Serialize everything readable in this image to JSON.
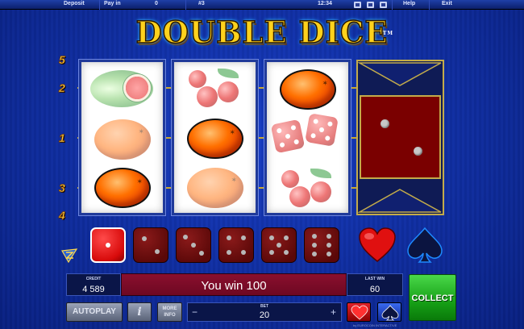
{
  "topbar": {
    "deposit": "Deposit",
    "pay_in": "Pay in",
    "pay_in_value": "0",
    "game_id": "#3",
    "clock": "12:34",
    "help": "Help",
    "exit": "Exit",
    "icons": [
      "sound-icon",
      "fullscreen-icon",
      "settings-icon"
    ]
  },
  "game": {
    "title": "DOUBLE DICE",
    "trademark": "TM"
  },
  "paylines": {
    "numbers": [
      "5",
      "2",
      "1",
      "3",
      "4"
    ]
  },
  "reels": [
    {
      "symbols": [
        "watermelon",
        "orange",
        "orange"
      ]
    },
    {
      "symbols": [
        "cherries",
        "orange",
        "orange"
      ]
    },
    {
      "symbols": [
        "orange",
        "dice",
        "cherries"
      ]
    }
  ],
  "gamble": {
    "card": "dice-two"
  },
  "dice_row": {
    "dice": [
      1,
      2,
      3,
      4,
      5,
      6
    ],
    "active_index": 0
  },
  "suits": [
    "heart",
    "spade"
  ],
  "panel": {
    "credit_label": "CREDIT",
    "credit_value": "4 589",
    "message": "You win 100",
    "last_win_label": "LAST WIN",
    "last_win_value": "60",
    "bet_label": "BET",
    "bet_value": "20",
    "bet_minus": "−",
    "bet_plus": "+"
  },
  "buttons": {
    "autoplay": "AUTOPLAY",
    "info_icon": "i",
    "more_info_line1": "MORE",
    "more_info_line2": "INFO",
    "collect": "COLLECT"
  },
  "footer": {
    "brand": "by EUROCOIN INTERACTIVE"
  },
  "colors": {
    "background": "#0d2fa6",
    "message_bar": "#8a0f2e",
    "collect": "#16a016",
    "gold": "#c9a832"
  }
}
